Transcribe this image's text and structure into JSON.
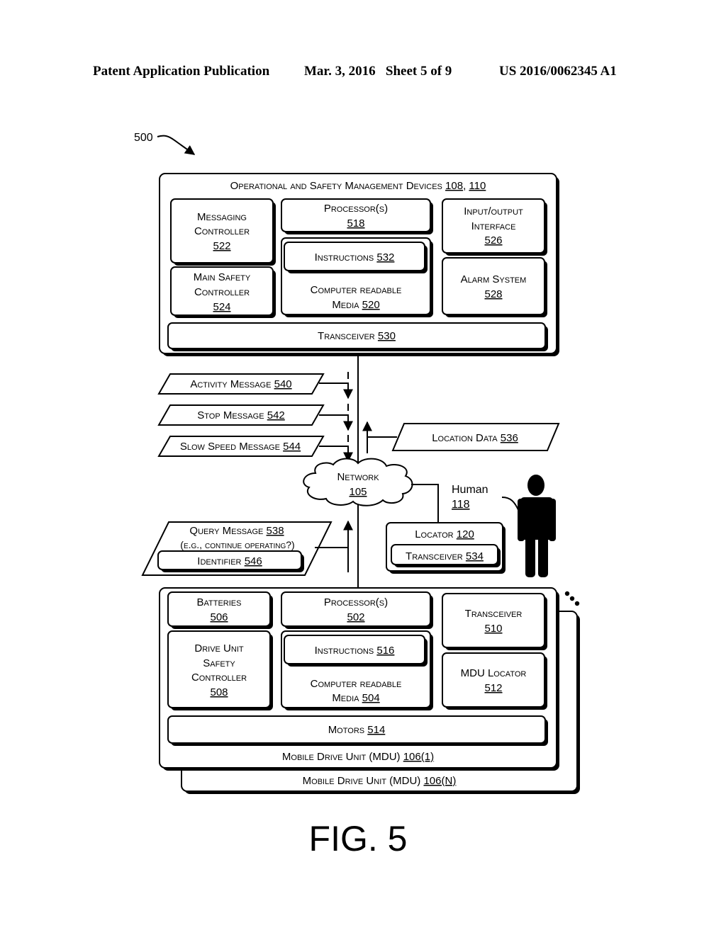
{
  "header": {
    "left": "Patent Application Publication",
    "date_sheet": "Mar. 3, 2016   Sheet 5 of 9",
    "number": "US 2016/0062345 A1"
  },
  "figure": {
    "ref": "500",
    "caption": "FIG. 5"
  },
  "management": {
    "title": "Operational and Safety Management Devices",
    "title_refs": [
      "108",
      "110"
    ],
    "messaging_controller": {
      "lines": [
        "Messaging",
        "Controller"
      ],
      "ref": "522"
    },
    "main_safety_controller": {
      "lines": [
        "Main Safety",
        "Controller"
      ],
      "ref": "524"
    },
    "processor": {
      "label": "Processor(s)",
      "ref": "518"
    },
    "instructions": {
      "label": "Instructions",
      "ref": "532"
    },
    "crm": {
      "lines": [
        "Computer readable",
        "Media"
      ],
      "ref": "520"
    },
    "io_interface": {
      "lines": [
        "Input/output",
        "Interface"
      ],
      "ref": "526"
    },
    "alarm": {
      "label": "Alarm System",
      "ref": "528"
    },
    "transceiver": {
      "label": "Transceiver",
      "ref": "530"
    }
  },
  "messages": {
    "activity": {
      "label": "Activity Message",
      "ref": "540"
    },
    "stop": {
      "label": "Stop Message",
      "ref": "542"
    },
    "slow": {
      "label": "Slow Speed Message",
      "ref": "544"
    },
    "location": {
      "label": "Location Data",
      "ref": "536"
    },
    "query": {
      "label": "Query Message",
      "ref": "538",
      "sub": "(e.g., continue operating?)"
    },
    "identifier": {
      "label": "Identifier",
      "ref": "546"
    }
  },
  "network": {
    "label": "Network",
    "ref": "105"
  },
  "human": {
    "label": "Human",
    "ref": "118"
  },
  "locator": {
    "label": "Locator",
    "ref": "120",
    "transceiver_label": "Transceiver",
    "transceiver_ref": "534"
  },
  "mdu": {
    "batteries": {
      "label": "Batteries",
      "ref": "506"
    },
    "drive_safety": {
      "lines": [
        "Drive Unit",
        "Safety",
        "Controller"
      ],
      "ref": "508"
    },
    "processor": {
      "label": "Processor(s)",
      "ref": "502"
    },
    "instructions": {
      "label": "Instructions",
      "ref": "516"
    },
    "crm": {
      "lines": [
        "Computer readable",
        "Media"
      ],
      "ref": "504"
    },
    "transceiver": {
      "label": "Transceiver",
      "ref": "510"
    },
    "locator": {
      "label": "MDU Locator",
      "ref": "512"
    },
    "motors": {
      "label": "Motors",
      "ref": "514"
    },
    "unit1": {
      "label": "Mobile Drive Unit (MDU)",
      "ref": "106(1)"
    },
    "unitN": {
      "label": "Mobile Drive Unit (MDU)",
      "ref": "106(N)"
    }
  }
}
